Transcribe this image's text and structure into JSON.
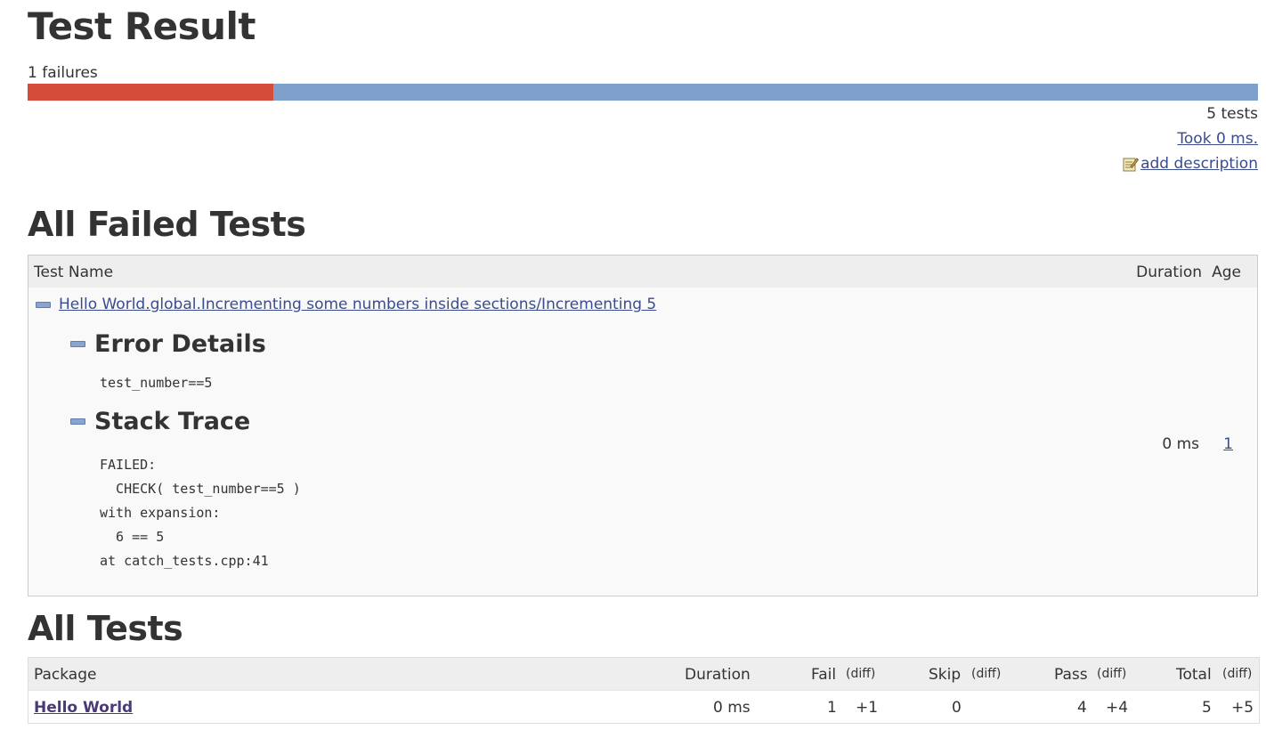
{
  "header": {
    "title": "Test Result",
    "failures_text": "1 failures",
    "tests_text": "5 tests",
    "took_link": "Took 0 ms.",
    "add_description_link": "add description",
    "progress": {
      "fail_fraction": 0.2,
      "fail_color": "#d54c3a",
      "pass_color": "#7f9fcc"
    }
  },
  "failed_section": {
    "heading": "All Failed Tests",
    "columns": {
      "name": "Test Name",
      "duration": "Duration",
      "age": "Age"
    },
    "test": {
      "name": "Hello World.global.Incrementing some numbers inside sections/Incrementing 5",
      "error_details_heading": "Error Details",
      "error_details": "test_number==5",
      "stack_trace_heading": "Stack Trace",
      "stack_trace": "FAILED:\n  CHECK( test_number==5 )\nwith expansion:\n  6 == 5\nat catch_tests.cpp:41",
      "duration": "0 ms",
      "age": "1"
    }
  },
  "all_section": {
    "heading": "All Tests",
    "columns": {
      "package": "Package",
      "duration": "Duration",
      "fail": "Fail",
      "fail_diff": "(diff)",
      "skip": "Skip",
      "skip_diff": "(diff)",
      "pass": "Pass",
      "pass_diff": "(diff)",
      "total": "Total",
      "total_diff": "(diff)"
    },
    "rows": [
      {
        "package": "Hello World",
        "duration": "0 ms",
        "fail": "1",
        "fail_diff": "+1",
        "skip": "0",
        "skip_diff": "",
        "pass": "4",
        "pass_diff": "+4",
        "total": "5",
        "total_diff": "+5"
      }
    ]
  },
  "icons": {
    "toggle": "collapse-icon",
    "note": "note-edit-icon"
  }
}
